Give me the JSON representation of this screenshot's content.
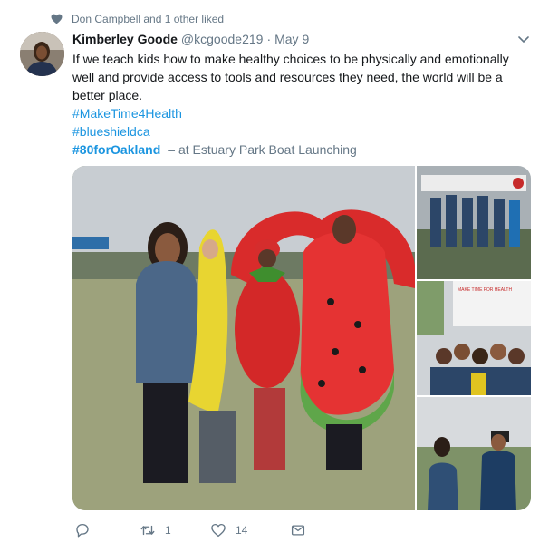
{
  "social_context": {
    "text": "Don Campbell and 1 other liked"
  },
  "tweet": {
    "author_name": "Kimberley Goode",
    "author_handle": "@kcgoode219",
    "separator": "·",
    "date": "May 9",
    "text": "If we teach kids how to make healthy choices to be physically and emotionally well and provide access to tools and resources they need, the world will be a better place.",
    "hashtags": [
      "#MakeTime4Health",
      "#blueshieldca",
      "#80forOakland"
    ],
    "location": "– at Estuary Park Boat Launching"
  },
  "media": {
    "main_photo_icon": "photo-group-costumes",
    "side_photos": [
      "photo-group-banner",
      "photo-kids-group",
      "photo-interview"
    ],
    "banner_text": "MAKE TIME FOR HEALTH"
  },
  "actions": {
    "reply_count": "",
    "retweet_count": "1",
    "like_count": "14",
    "dm_count": ""
  },
  "colors": {
    "link": "#1b95e0",
    "secondary_text": "#657786",
    "primary_text": "#14171a"
  }
}
